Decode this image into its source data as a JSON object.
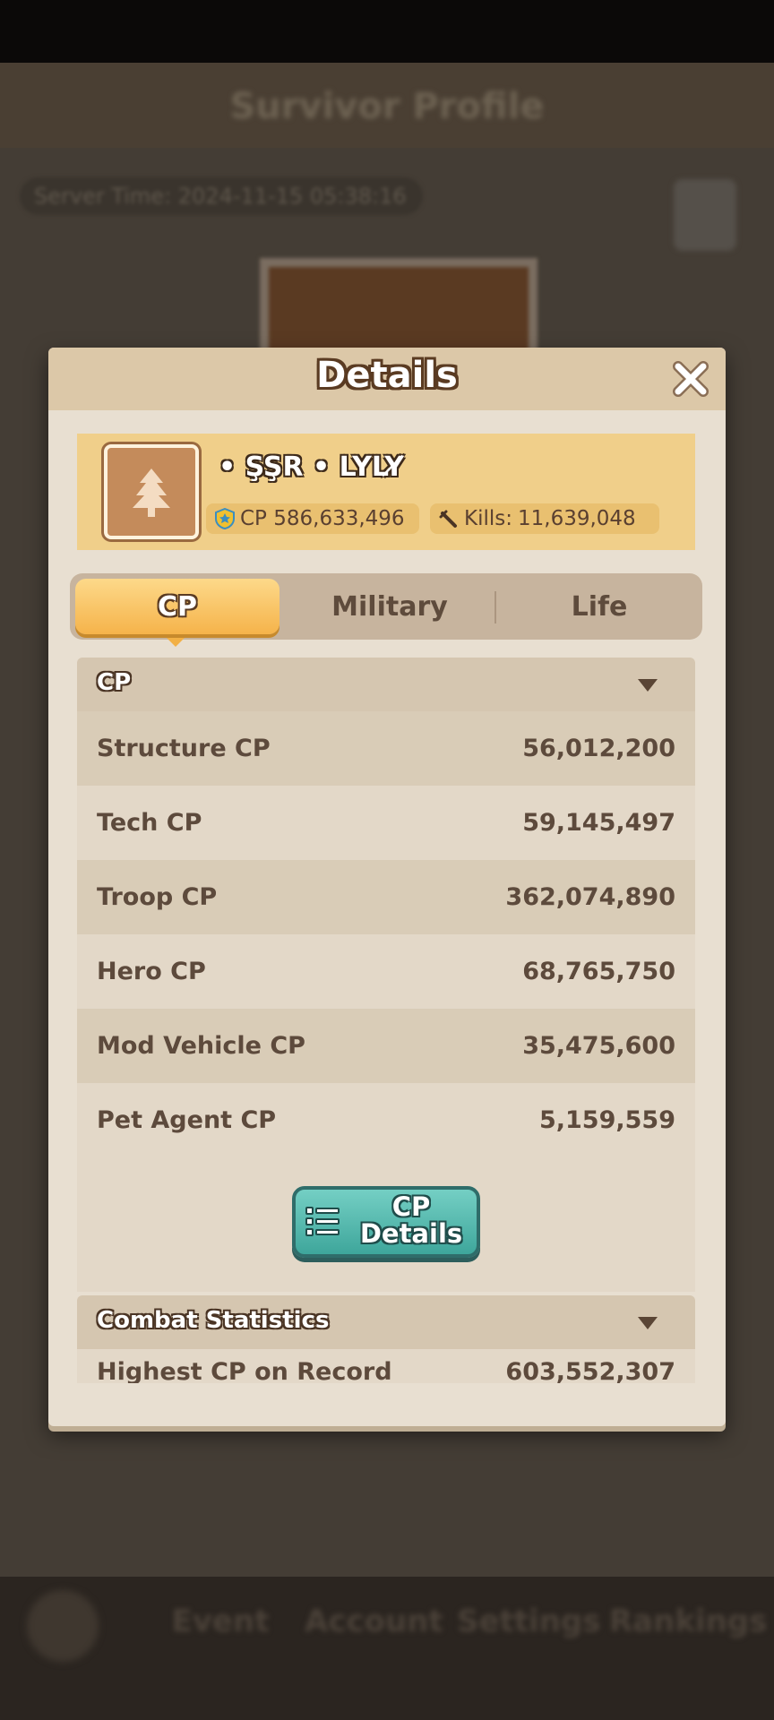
{
  "background": {
    "title": "Survivor Profile",
    "time_text": "Server Time: 2024-11-15 05:38:16",
    "nav": [
      "Event",
      "Account",
      "Settings",
      "Rankings"
    ]
  },
  "dialog": {
    "title": "Details",
    "player": {
      "name": "• ŞŞR • LYLY̸",
      "cp_label": "CP 586,633,496",
      "kills_label": "Kills:",
      "kills_value": "11,639,048"
    },
    "tabs": [
      {
        "label": "CP",
        "active": true
      },
      {
        "label": "Military",
        "active": false
      },
      {
        "label": "Life",
        "active": false
      }
    ],
    "cp_section": {
      "title": "CP",
      "rows": [
        {
          "label": "Structure CP",
          "value": "56,012,200"
        },
        {
          "label": "Tech CP",
          "value": "59,145,497"
        },
        {
          "label": "Troop CP",
          "value": "362,074,890"
        },
        {
          "label": "Hero CP",
          "value": "68,765,750"
        },
        {
          "label": "Mod Vehicle CP",
          "value": "35,475,600"
        },
        {
          "label": "Pet Agent CP",
          "value": "5,159,559"
        }
      ],
      "button_label_line1": "CP",
      "button_label_line2": "Details"
    },
    "combat_section": {
      "title": "Combat Statistics",
      "rows": [
        {
          "label": "Highest CP on Record",
          "value": "603,552,307"
        }
      ]
    }
  },
  "colors": {
    "accent_tab": "#f5b34a",
    "button_teal": "#3ea69b",
    "panel": "#e8dfd1"
  },
  "icons": [
    "close-icon",
    "tree-icon",
    "shield-icon",
    "sword-icon",
    "dropdown-arrow-icon",
    "list-icon"
  ]
}
